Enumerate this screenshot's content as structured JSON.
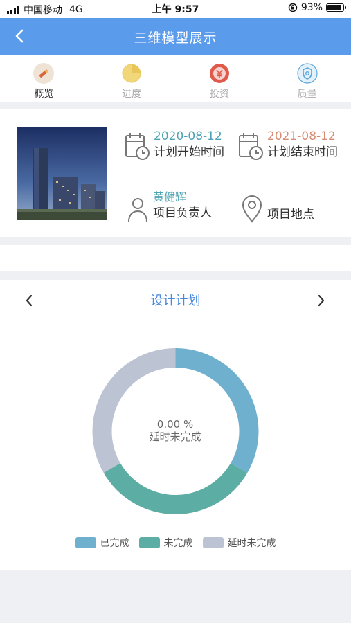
{
  "status_bar": {
    "carrier": "中国移动",
    "network": "4G",
    "time": "上午 9:57",
    "battery": "93%",
    "battery_level": 0.93
  },
  "nav": {
    "title": "三维模型展示",
    "back_icon": "chevron-left-icon"
  },
  "tabs": [
    {
      "label": "概览",
      "icon": "pencil-icon",
      "active": true
    },
    {
      "label": "进度",
      "icon": "pie-progress-icon",
      "active": false
    },
    {
      "label": "投资",
      "icon": "yen-coin-icon",
      "active": false
    },
    {
      "label": "质量",
      "icon": "shield-icon",
      "active": false
    }
  ],
  "project": {
    "start_date": "2020-08-12",
    "start_label": "计划开始时间",
    "end_date": "2021-08-12",
    "end_label": "计划结束时间",
    "manager_name": "黄健辉",
    "manager_label": "项目负责人",
    "location_label": "项目地点"
  },
  "colors": {
    "nav": "#5b9bec",
    "teal_text": "#4ba4b3",
    "red_text": "#d98a72",
    "completed": "#6fb0cf",
    "not_completed": "#5caea4",
    "delayed": "#bcc3d3"
  },
  "plan": {
    "title": "设计计划",
    "prev_icon": "chevron-left-icon",
    "next_icon": "chevron-right-icon",
    "center_value": "0.00 %",
    "center_label": "延时未完成"
  },
  "chart_data": {
    "type": "pie",
    "categories": [
      "已完成",
      "未完成",
      "延时未完成"
    ],
    "values": [
      0.33333,
      0.33333,
      0.33333
    ]
  }
}
